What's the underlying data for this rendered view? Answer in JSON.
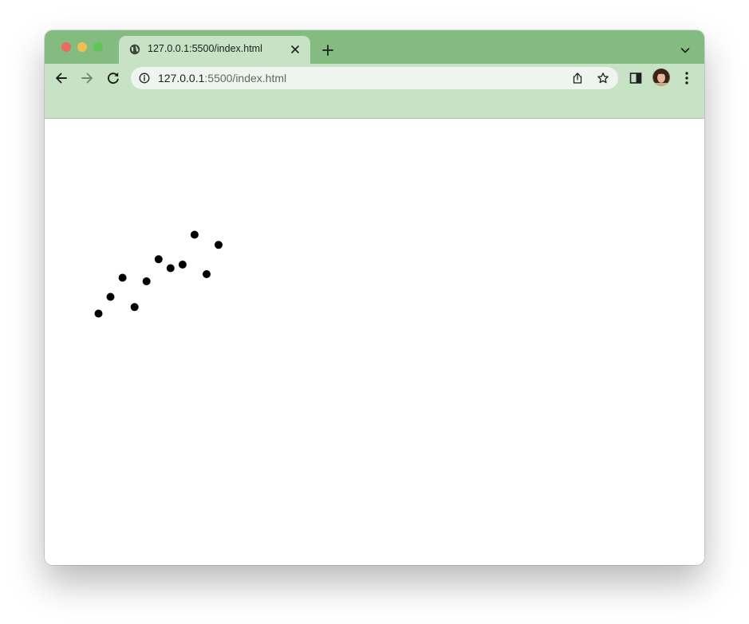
{
  "browser": {
    "tab": {
      "title": "127.0.0.1:5500/index.html",
      "icon": "globe-icon"
    },
    "address_bar": {
      "host": "127.0.0.1",
      "path": ":5500/index.html"
    },
    "colors": {
      "frame": "#83bb80",
      "toolbar": "#c7e2c5",
      "omnibox": "#eef5ee"
    }
  },
  "page": {
    "background": "#ffffff"
  },
  "chart_data": {
    "type": "scatter",
    "title": "",
    "xlabel": "",
    "ylabel": "",
    "grid": false,
    "point_color": "#000000",
    "series": [
      {
        "x": [
          0,
          1,
          2,
          3,
          4,
          5,
          6,
          7,
          8,
          9,
          10
        ],
        "y": [
          0,
          1.4,
          3,
          0.55,
          2.7,
          4.55,
          3.8,
          4.1,
          6.6,
          3.3,
          5.75
        ]
      }
    ]
  }
}
